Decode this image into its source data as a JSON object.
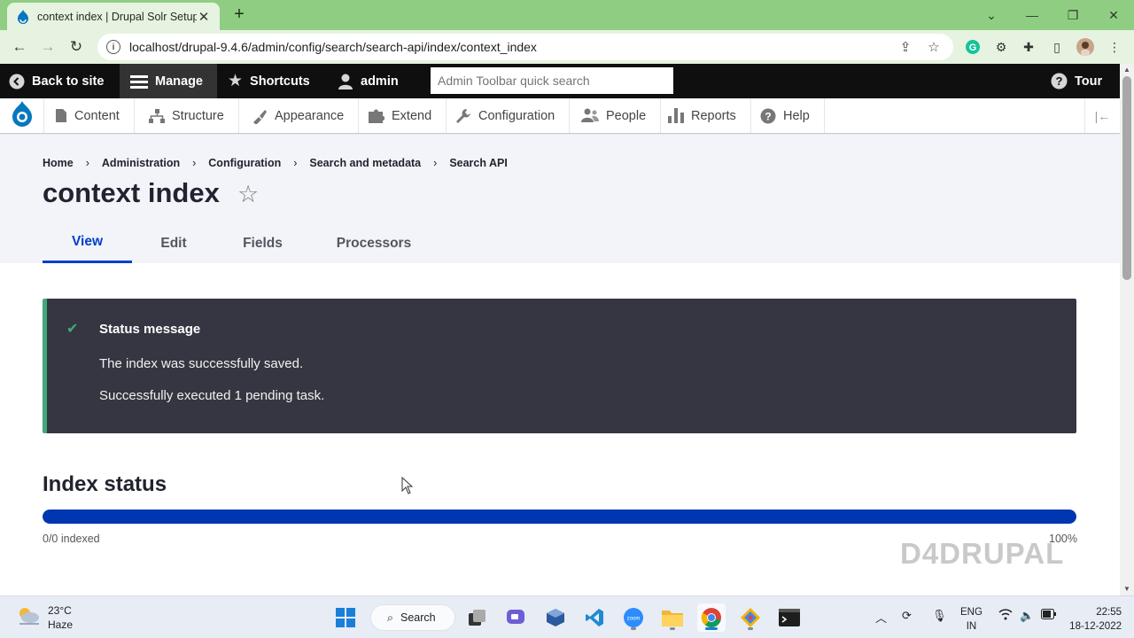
{
  "browser": {
    "tab_title": "context index | Drupal Solr Setup",
    "url": "localhost/drupal-9.4.6/admin/config/search/search-api/index/context_index"
  },
  "admin_toolbar": {
    "back_to_site": "Back to site",
    "manage": "Manage",
    "shortcuts": "Shortcuts",
    "user": "admin",
    "search_placeholder": "Admin Toolbar quick search",
    "tour": "Tour"
  },
  "tray": {
    "items": [
      "Content",
      "Structure",
      "Appearance",
      "Extend",
      "Configuration",
      "People",
      "Reports",
      "Help"
    ]
  },
  "breadcrumb": [
    "Home",
    "Administration",
    "Configuration",
    "Search and metadata",
    "Search API"
  ],
  "page": {
    "title": "context index",
    "tabs": [
      "View",
      "Edit",
      "Fields",
      "Processors"
    ],
    "active_tab": "View"
  },
  "status": {
    "heading": "Status message",
    "messages": [
      "The index was successfully saved.",
      "Successfully executed 1 pending task."
    ]
  },
  "index_status": {
    "title": "Index status",
    "indexed_label": "0/0 indexed",
    "percent_label": "100%",
    "progress": 1.0
  },
  "watermark": "D4DRUPAL",
  "taskbar": {
    "weather_temp": "23°C",
    "weather_desc": "Haze",
    "search_label": "Search",
    "lang_1": "ENG",
    "lang_2": "IN",
    "time": "22:55",
    "date": "18-12-2022"
  },
  "colors": {
    "accent": "#003ecc",
    "status_border": "#42a877",
    "status_bg": "#353641",
    "progress_fill": "#0036b1"
  }
}
